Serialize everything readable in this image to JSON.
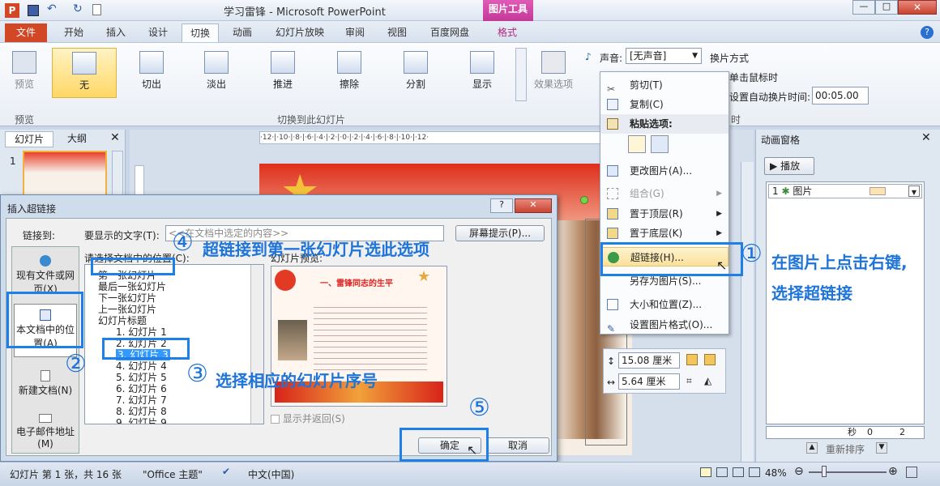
{
  "app": {
    "title": "学习雷锋 - Microsoft PowerPoint",
    "context_tab": "图片工具"
  },
  "tabs": [
    "文件",
    "开始",
    "插入",
    "设计",
    "切换",
    "动画",
    "幻灯片放映",
    "审阅",
    "视图",
    "百度网盘",
    "格式"
  ],
  "ribbon": {
    "preview_label": "预览",
    "preview_group": "预览",
    "transitions": [
      "无",
      "切出",
      "淡出",
      "推进",
      "擦除",
      "分割",
      "显示"
    ],
    "effect_options": "效果选项",
    "group_transition": "切换到此幻灯片",
    "sound_label": "声音:",
    "sound_value": "[无声音]",
    "switch_mode": "换片方式",
    "on_click": "单击鼠标时",
    "auto_time_label": "设置自动换片时间:",
    "auto_time_value": "00:05.00",
    "group_timing": "时"
  },
  "left_pane": {
    "tab_slides": "幻灯片",
    "tab_outline": "大纲",
    "slide_num": "1"
  },
  "ruler": "·12·|·10·|·8·|·6·|·4·|·2·|·0·|·2·|·4·|·6·|·8·|·10·|·12·",
  "context_menu": {
    "items": [
      "剪切(T)",
      "复制(C)",
      "粘贴选项:",
      "更改图片(A)...",
      "组合(G)",
      "置于顶层(R)",
      "置于底层(K)",
      "超链接(H)...",
      "另存为图片(S)...",
      "大小和位置(Z)...",
      "设置图片格式(O)..."
    ]
  },
  "size_box": {
    "height": "15.08",
    "width": "5.64",
    "unit": "厘米"
  },
  "anim_pane": {
    "title": "动画窗格",
    "play": "播放",
    "item_num": "1",
    "item_label": "图片",
    "seconds": "秒",
    "zero": "0",
    "two": "2",
    "reorder": "重新排序"
  },
  "dialog": {
    "title": "插入超链接",
    "link_to": "链接到:",
    "text_label": "要显示的文字(T):",
    "text_value": "<<在文档中选定的内容>>",
    "screentip": "屏幕提示(P)...",
    "select_place": "请选择文档中的位置(C):",
    "preview_label": "幻灯片预览:",
    "tree": [
      "第一张幻灯片",
      "最后一张幻灯片",
      "下一张幻灯片",
      "上一张幻灯片",
      "幻灯片标题",
      "1. 幻灯片 1",
      "2. 幻灯片 2",
      "3. 幻灯片 3",
      "4. 幻灯片 4",
      "5. 幻灯片 5",
      "6. 幻灯片 6",
      "7. 幻灯片 7",
      "8. 幻灯片 8",
      "9. 幻灯片 9"
    ],
    "left_buttons": [
      "现有文件或网页(X)",
      "本文档中的位置(A)",
      "新建文档(N)",
      "电子邮件地址(M)"
    ],
    "show_return": "显示并返回(S)",
    "ok": "确定",
    "cancel": "取消",
    "preview_title": "一、雷锋同志的生平"
  },
  "annotations": {
    "a1_num": "①",
    "a1_text_line1": "在图片上点击右键,",
    "a1_text_line2": "选择超链接",
    "a2_num": "②",
    "a3_num": "③",
    "a3_text": "选择相应的幻灯片序号",
    "a4_num": "④",
    "a4_text": "超链接到第一张幻灯片选此选项",
    "a5_num": "⑤"
  },
  "status": {
    "slide_info": "幻灯片 第 1 张，共 16 张",
    "theme": "\"Office 主题\"",
    "lang": "中文(中国)",
    "zoom": "48%"
  }
}
